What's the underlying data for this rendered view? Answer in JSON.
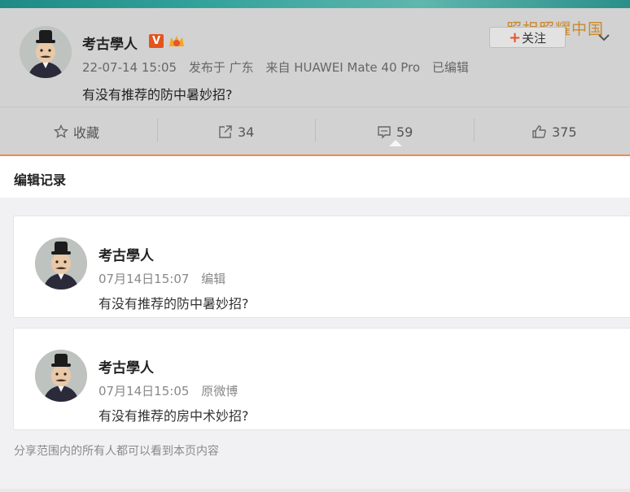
{
  "post": {
    "author": "考古學人",
    "verified_badge": "V",
    "meta": {
      "datetime": "22-07-14 15:05",
      "location": "发布于 广东",
      "source": "来自 HUAWEI Mate 40 Pro",
      "edited": "已编辑"
    },
    "text": "有没有推荐的防中暑妙招?",
    "watermark": "照相照耀中国",
    "follow_label": "关注",
    "actions": {
      "favorite": "收藏",
      "repost": "34",
      "comment": "59",
      "like": "375"
    }
  },
  "edit_history": {
    "title": "编辑记录",
    "records": [
      {
        "author": "考古學人",
        "time": "07月14日15:07",
        "type": "编辑",
        "text": "有没有推荐的防中暑妙招?"
      },
      {
        "author": "考古學人",
        "time": "07月14日15:05",
        "type": "原微博",
        "text": "有没有推荐的房中术妙招?"
      }
    ],
    "note": "分享范围内的所有人都可以看到本页内容"
  },
  "colors": {
    "accent_orange": "#f08a4b",
    "verified_red": "#e3541f",
    "watermark_gold": "#c9892f"
  },
  "icons": {
    "favorite": "star-icon",
    "repost": "share-icon",
    "comment": "comment-icon",
    "like": "thumbs-up-icon",
    "menu": "chevron-down-icon"
  }
}
